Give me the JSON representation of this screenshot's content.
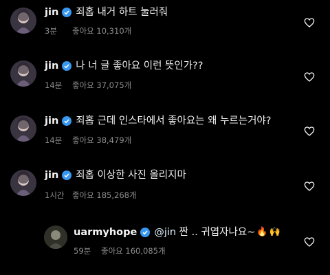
{
  "comments": [
    {
      "username": "jin",
      "text": "죄홉 내거 하트 눌러줘",
      "time": "3분",
      "likes": "좋아요 10,310개"
    },
    {
      "username": "jin",
      "text": "나 너 글 좋아요 이런 뜻인가??",
      "time": "14분",
      "likes": "좋아요 37,075개"
    },
    {
      "username": "jin",
      "text": "죄홉 근데 인스타에서 좋아요는 왜 누르는거야?",
      "time": "14분",
      "likes": "좋아요 38,479개"
    },
    {
      "username": "jin",
      "text": "죄홉 이상한 사진 올리지마",
      "time": "1시간",
      "likes": "좋아요 185,268개"
    }
  ],
  "reply": {
    "username": "uarmyhope",
    "mention": "@jin",
    "text": " 짠 .. 귀엽자나요~",
    "emoji": [
      "🔥",
      "🙌"
    ],
    "time": "59분",
    "likes": "좋아요 160,085개"
  },
  "colors": {
    "background": "#000000",
    "verified": "#3897f0",
    "meta": "#8e8e8e"
  },
  "icons": {
    "verified": "verified-badge-icon",
    "like": "heart-outline-icon"
  }
}
